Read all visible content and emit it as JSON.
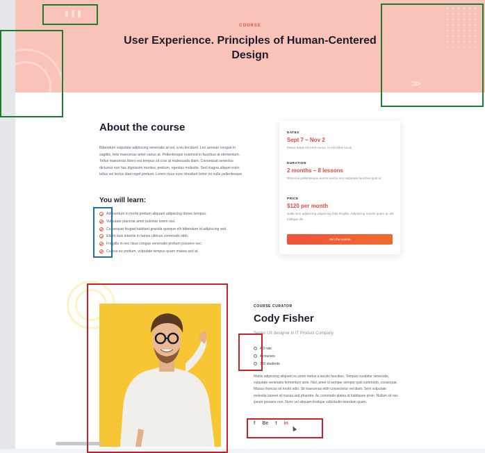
{
  "hero": {
    "eyebrow": "COURSE",
    "title": "User Experience. Principles of Human-Centered Design"
  },
  "about": {
    "title": "About the course",
    "body": "Bibendum vulputate adipiscing venenatis at est, a eu tincidunt. Leo aenean congue in sagittis, felis maecenas amet varius at. Pellentesque euismod in faucibus at elementum. Tellus maecenas libero est tempus sit cras at malesuada diam. Consequat senectus dictumst non hac dignissim montes, pretium, egestas molestie. Sed magna aliquet enim tellus vel lectus diam eget pretium. Lorem risus nunc tincidunt tortor mi nulla pellentesque.",
    "learn_title": "You will learn:",
    "learn_items": [
      "Adimentum in morbi pretium aliquam adipiscing donec tempus.",
      "Vulputate placerat amet pulvinar lorem nisl.",
      "Consequat feugiat habitant gravida quisque elit bibendum id adipiscing sed.",
      "Etiam duis lobortis in fames ultrices commodo nibh.",
      "Fringilla in nec risus congue venenatis pretium posuere nec.",
      "Cursus eu pretium, vulputate tempus quam massa sed at."
    ]
  },
  "card": {
    "dates_label": "DATES",
    "dates_value": "Sept 7 – Nov 2",
    "dates_note": "Metus turpis sit lorem lacus, in elit tellus lacus.",
    "duration_label": "DURATION",
    "duration_value": "2 months – 8 lessons",
    "duration_note": "Rhoncus pellentesque auctor auctor orci vulputate faucibus quis ut.",
    "price_label": "PRICE",
    "price_value": "$120 per month",
    "price_note": "Nulla sem adipiscing adipiscing felis fringilla. Adipiscing mauris quam ac elit tristique dis.",
    "button_label": "Join the course"
  },
  "curator": {
    "eyebrow": "COURSE CURATOR",
    "name": "Cody Fisher",
    "role": "Senior UX designer in IT Product Company",
    "stats": [
      "4.9 rate",
      "4 courses",
      "350 students"
    ],
    "bio": "Mattis adipiscing aliquam eu proin metus a iaculis faucibus. Tempus curabitur venenatis, vulputate venenatis fermentum ante. Nisl, amet id semper semper quis commodo, consequat. Massa rhoncus sit morbi odio. Sit maecenas nibh consectetur vel diam. Sem vulputate molestie laoreet at massa sed pharetra. Ac commodo platea id habitasse proin. Nullam sit nec ipsum posuere non. Nunc vel aliquam tristique sollicitudin interdum quam.",
    "socials": [
      "f",
      "Be",
      "t",
      "in"
    ]
  },
  "colors": {
    "accent": "#e04c45",
    "hero_bg": "#f9c3b9",
    "photo_bg": "#f7c634"
  }
}
